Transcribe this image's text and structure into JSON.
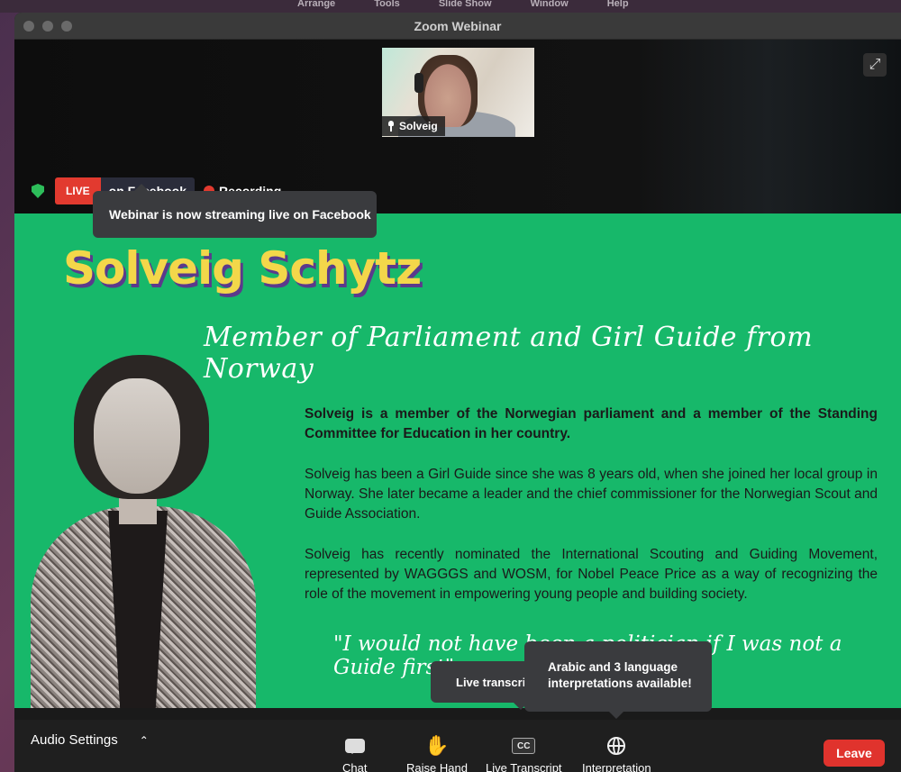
{
  "menubar": [
    "Arrange",
    "Tools",
    "Slide Show",
    "Window",
    "Help"
  ],
  "window": {
    "title": "Zoom Webinar"
  },
  "thumbnail": {
    "name": "Solveig"
  },
  "status": {
    "live": "LIVE",
    "platform": "on Facebook",
    "recording": "Recording"
  },
  "tooltips": {
    "facebook": "Webinar is now streaming live on Facebook",
    "transcript": "Live transcript",
    "interpretation": "Arabic and 3 language interpretations available!"
  },
  "slide": {
    "name": "Solveig Schytz",
    "subtitle": "Member of Parliament and Girl Guide from Norway",
    "bio": [
      "Solveig is a member of the Norwegian parliament and a member of the Standing Committee for Education in her country.",
      "Solveig has been a Girl Guide since she was 8 years old, when she joined her local group in Norway. She later became a leader and the chief commissioner for the Norwegian Scout and Guide Association.",
      "Solveig has recently nominated the International Scouting and Guiding Movement, represented by WAGGGS and WOSM, for Nobel Peace Price as a way of recognizing the role of the movement in empowering young people and building society."
    ],
    "quote": "\"I would not have been a politician if I was not a Guide first\""
  },
  "toolbar": {
    "audio_settings": "Audio Settings",
    "chat": "Chat",
    "raise_hand": "Raise Hand",
    "live_transcript": "Live Transcript",
    "cc": "CC",
    "interpretation": "Interpretation",
    "leave": "Leave"
  },
  "colors": {
    "slide_bg": "#17b86a",
    "name_yellow": "#f3d74a",
    "live_red": "#e23a2f",
    "leave_red": "#e0332d"
  }
}
